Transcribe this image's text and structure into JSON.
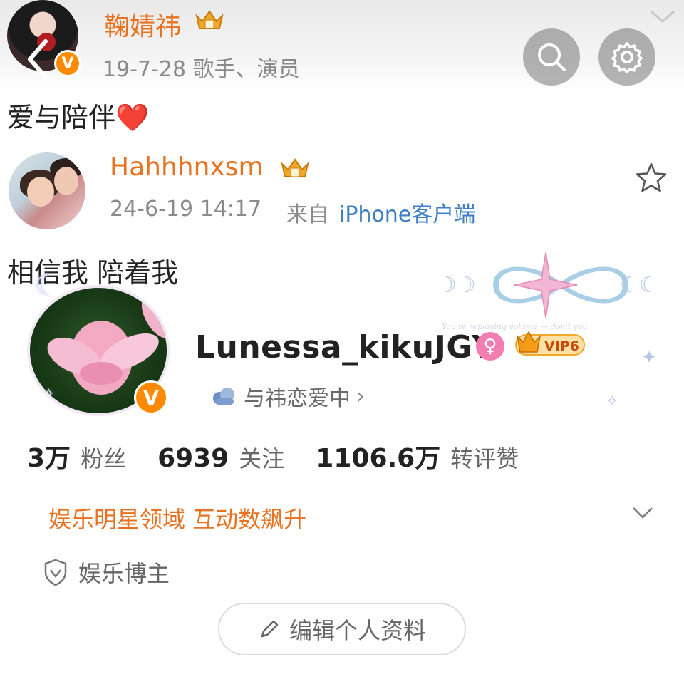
{
  "post1": {
    "author": "鞠婧祎",
    "meta": "19-7-28  歌手、演员",
    "text": "爱与陪伴❤️",
    "verified_badge": "V"
  },
  "top_bar": {
    "back_icon": "chevron-left-icon",
    "search_icon": "search-icon",
    "settings_icon": "gear-icon"
  },
  "post2": {
    "author": "Hahhhnxsm",
    "timestamp": "24-6-19 14:17",
    "source_prefix": "来自",
    "source": "iPhone客户端",
    "text": "相信我 陪着我",
    "star_icon": "star-icon"
  },
  "profile": {
    "username": "Lunessa_kikuJGY",
    "gender_symbol": "♀",
    "vip_label": "VIP6",
    "verified_badge": "V",
    "status": "与祎恋爱中",
    "status_chevron": "›",
    "decoration_text": "You're replaying volume — don't you"
  },
  "stats": [
    {
      "value": "3万",
      "label": "粉丝"
    },
    {
      "value": "6939",
      "label": "关注"
    },
    {
      "value": "1106.6万",
      "label": "转评赞"
    }
  ],
  "domain_banner": "娱乐明星领域 互动数飙升",
  "tag": "娱乐博主",
  "edit_button": "编辑个人资料",
  "colors": {
    "accent_orange": "#e8721f",
    "badge_orange": "#ff8a00",
    "link_blue": "#3e7fc4",
    "gender_pink": "#f27db0"
  }
}
